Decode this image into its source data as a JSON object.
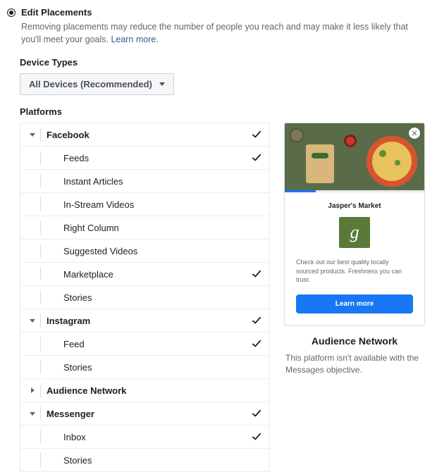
{
  "header": {
    "title": "Edit Placements",
    "description_prefix": "Removing placements may reduce the number of people you reach and may make it less likely that you'll meet your goals. ",
    "learn_more": "Learn more."
  },
  "device_types": {
    "label": "Device Types",
    "selected": "All Devices (Recommended)"
  },
  "platforms": {
    "label": "Platforms",
    "groups": [
      {
        "name": "Facebook",
        "expanded": true,
        "checked": true,
        "items": [
          {
            "label": "Feeds",
            "checked": true
          },
          {
            "label": "Instant Articles",
            "checked": false
          },
          {
            "label": "In-Stream Videos",
            "checked": false
          },
          {
            "label": "Right Column",
            "checked": false
          },
          {
            "label": "Suggested Videos",
            "checked": false
          },
          {
            "label": "Marketplace",
            "checked": true
          },
          {
            "label": "Stories",
            "checked": false
          }
        ]
      },
      {
        "name": "Instagram",
        "expanded": true,
        "checked": true,
        "items": [
          {
            "label": "Feed",
            "checked": true
          },
          {
            "label": "Stories",
            "checked": false
          }
        ]
      },
      {
        "name": "Audience Network",
        "expanded": false,
        "checked": false,
        "items": []
      },
      {
        "name": "Messenger",
        "expanded": true,
        "checked": true,
        "items": [
          {
            "label": "Inbox",
            "checked": true
          },
          {
            "label": "Stories",
            "checked": false
          }
        ]
      }
    ]
  },
  "preview": {
    "brand": "Jasper's Market",
    "logo_glyph": "g",
    "body_text": "Check out our best quality locally sourced products. Freshness you can trust.",
    "cta": "Learn more",
    "title": "Audience Network",
    "description": "This platform isn't available with the Messages objective."
  }
}
